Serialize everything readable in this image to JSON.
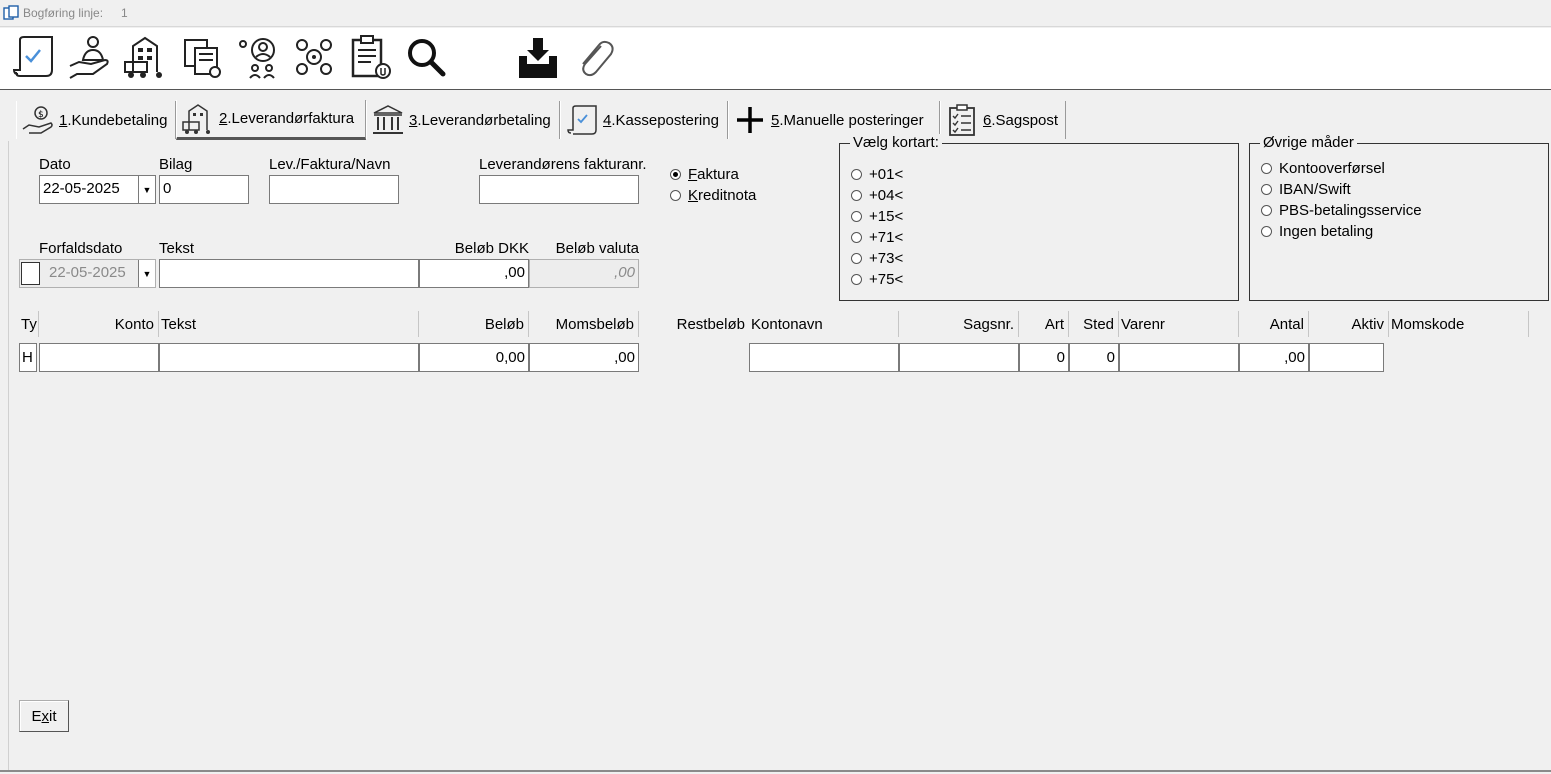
{
  "window": {
    "title": "Bogføring linje:",
    "record_number": "1"
  },
  "toolbar": {
    "buttons": [
      {
        "name": "document-check-icon"
      },
      {
        "name": "hand-person-icon"
      },
      {
        "name": "building-truck-icon"
      },
      {
        "name": "documents-gear-icon"
      },
      {
        "name": "people-search-icon"
      },
      {
        "name": "settings-circle-icon"
      },
      {
        "name": "clipboard-attach-icon"
      },
      {
        "name": "search-icon"
      },
      {
        "name": "inbox-download-icon"
      },
      {
        "name": "paperclip-icon"
      }
    ]
  },
  "tabs": [
    {
      "num": "1",
      "label": ".Kundebetaling",
      "icon": "money-hand-icon"
    },
    {
      "num": "2",
      "label": ".Leverandørfaktura",
      "icon": "building-truck-icon"
    },
    {
      "num": "3",
      "label": ".Leverandørbetaling",
      "icon": "bank-icon"
    },
    {
      "num": "4",
      "label": ".Kassepostering",
      "icon": "document-check-icon"
    },
    {
      "num": "5",
      "label": ".Manuelle posteringer",
      "icon": "plus-icon"
    },
    {
      "num": "6",
      "label": ".Sagspost",
      "icon": "checklist-icon"
    }
  ],
  "active_tab": 1,
  "form": {
    "dato_label": "Dato",
    "dato_value": "22-05-2025",
    "bilag_label": "Bilag",
    "bilag_value": "0",
    "lev_label": "Lev./Faktura/Navn",
    "lev_value": "",
    "fakturanr_label": "Leverandørens fakturanr.",
    "fakturanr_value": "",
    "forfald_label": "Forfaldsdato",
    "forfald_value": "22-05-2025",
    "tekst_label": "Tekst",
    "tekst_value": "",
    "beloeb_dkk_label": "Beløb DKK",
    "beloeb_dkk_value": ",00",
    "beloeb_valuta_label": "Beløb valuta",
    "beloeb_valuta_value": ",00"
  },
  "doc_type": {
    "faktura_first": "F",
    "faktura_rest": "aktura",
    "kreditnota_first": "K",
    "kreditnota_rest": "reditnota",
    "selected": "faktura"
  },
  "kortart": {
    "title": "Vælg kortart:",
    "options": [
      "+01<",
      "+04<",
      "+15<",
      "+71<",
      "+73<",
      "+75<"
    ]
  },
  "ovrige": {
    "title": "Øvrige måder",
    "options": [
      "Kontooverførsel",
      "IBAN/Swift",
      "PBS-betalingsservice",
      "Ingen betaling"
    ]
  },
  "grid": {
    "headers": {
      "type": "Ty",
      "konto": "Konto",
      "tekst": "Tekst",
      "beloeb": "Beløb",
      "moms": "Momsbeløb",
      "rest": "Restbeløb",
      "kontonavn": "Kontonavn",
      "sagsnr": "Sagsnr.",
      "art": "Art",
      "sted": "Sted",
      "varenr": "Varenr",
      "antal": "Antal",
      "aktiv": "Aktiv",
      "momskode": "Momskode"
    },
    "row": {
      "type": "H",
      "konto": "",
      "tekst": "",
      "beloeb": "0,00",
      "moms": ",00",
      "kontonavn": "",
      "sagsnr": "",
      "art": "0",
      "sted": "0",
      "varenr": "",
      "antal": ",00",
      "aktiv": ""
    }
  },
  "exit": {
    "first": "E",
    "underlined": "x",
    "rest": "it"
  }
}
